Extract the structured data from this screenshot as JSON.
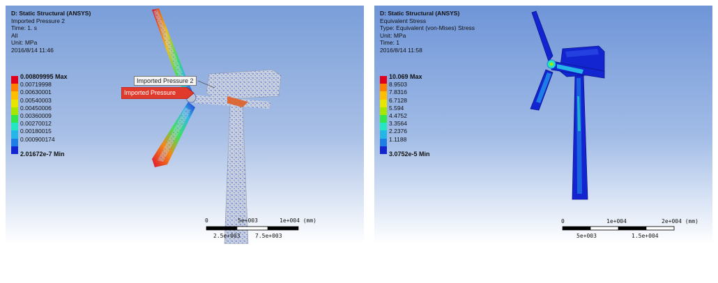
{
  "left_view": {
    "title": "D: Static Structural (ANSYS)",
    "lines": [
      "Imported Pressure 2",
      "Time: 1. s",
      "All",
      "Unit: MPa",
      "2016/8/14 11:46"
    ],
    "legend": {
      "max": "0.00809995 Max",
      "values": [
        "0.00719998",
        "0.00630001",
        "0.00540003",
        "0.00450006",
        "0.00360009",
        "0.00270012",
        "0.00180015",
        "0.000900174"
      ],
      "min": "2.01672e-7 Min",
      "colors": [
        "#e0001b",
        "#ff7f00",
        "#ffbf00",
        "#e6e600",
        "#a7e600",
        "#33e64d",
        "#25e6c2",
        "#25b5e6",
        "#1d7ee6",
        "#1325d0"
      ]
    },
    "callouts": {
      "pressure_2": "Imported Pressure 2",
      "pressure_1": "Imported Pressure"
    },
    "scale": {
      "top": [
        "0",
        "5e+003",
        "1e+004 (mm)"
      ],
      "bottom": [
        "2.5e+003",
        "7.5e+003"
      ]
    }
  },
  "right_view": {
    "title": "D: Static Structural (ANSYS)",
    "lines": [
      "Equivalent Stress",
      "Type: Equivalent (von-Mises) Stress",
      "Unit: MPa",
      "Time: 1",
      "2016/8/14 11:58"
    ],
    "legend": {
      "max": "10.069 Max",
      "values": [
        "8.9503",
        "7.8316",
        "6.7128",
        "5.594",
        "4.4752",
        "3.3564",
        "2.2376",
        "1.1188"
      ],
      "min": "3.0752e-5 Min",
      "colors": [
        "#e0001b",
        "#ff7f00",
        "#ffbf00",
        "#e6e600",
        "#a7e600",
        "#33e64d",
        "#25e6c2",
        "#25b5e6",
        "#1d7ee6",
        "#1325d0"
      ]
    },
    "scale": {
      "top": [
        "0",
        "1e+004",
        "2e+004 (mm)"
      ],
      "bottom": [
        "5e+003",
        "1.5e+004"
      ]
    }
  }
}
